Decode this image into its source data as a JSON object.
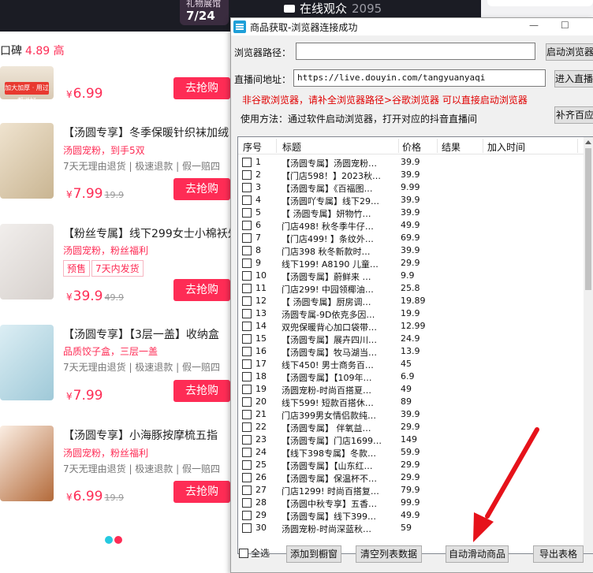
{
  "shop": {
    "gift_label": "礼物展馆",
    "gift_date": "7/24",
    "online_label": "在线观众",
    "online_count": "2095",
    "rating_label": "口碑",
    "rating_value": "4.89 高",
    "buy_label": "去抢购",
    "currency": "¥",
    "products": [
      {
        "title": "",
        "sub": "",
        "service": "",
        "price": "6.99",
        "orig": "",
        "badge": "加大加厚 · 用过都说好"
      },
      {
        "title": "【汤圆专享】冬季保暖针织袜加绒",
        "sub": "汤圆宠粉，到手5双",
        "service": "7天无理由退货 | 极速退款 | 假一赔四",
        "price": "7.99",
        "orig": "19.9"
      },
      {
        "title": "【粉丝专属】线下299女士小棉袄外",
        "sub": "汤圆宠粉，粉丝福利",
        "tags": [
          "预售",
          "7天内发货"
        ],
        "price": "39.9",
        "orig": "49.9"
      },
      {
        "title": "【汤圆专享】【3层一盖】收纳盒",
        "sub": "品质饺子盒，三层一盖",
        "service": "7天无理由退货 | 极速退款 | 假一赔四",
        "price": "7.99",
        "orig": ""
      },
      {
        "title": "【汤圆专享】小海豚按摩梳五指",
        "sub": "汤圆宠粉，粉丝福利",
        "service": "7天无理由退货 | 极速退款 | 假一赔四",
        "price": "6.99",
        "orig": "19.9"
      }
    ]
  },
  "window": {
    "title": "商品获取-浏览器连接成功",
    "minimize": "—",
    "maximize": "☐",
    "browser_path_label": "浏览器路径：",
    "browser_path_value": "",
    "start_browser_btn": "启动浏览器",
    "live_url_label": "直播间地址：",
    "live_url_value": "https://live.douyin.com/tangyuanyaqi",
    "enter_live_btn": "进入直播间",
    "red_tip": "非谷歌浏览器，请补全浏览器路径>谷歌浏览器 可以直接启动浏览器",
    "usage_text": "使用方法：通过软件启动浏览器，打开对应的抖音直播间",
    "fill_btn": "补齐百应",
    "columns": {
      "no": "序号",
      "title": "标题",
      "price": "价格",
      "result": "结果",
      "time": "加入时间"
    },
    "rows": [
      {
        "no": "1",
        "title": "【汤圆专属】汤圆宠粉…",
        "price": "39.9"
      },
      {
        "no": "2",
        "title": "【门店598！】2023秋…",
        "price": "39.9"
      },
      {
        "no": "3",
        "title": "【汤圆专属】《百福图…",
        "price": "9.99"
      },
      {
        "no": "4",
        "title": "【汤圆吖专属】线下29…",
        "price": "39.9"
      },
      {
        "no": "5",
        "title": "【  汤圆专属】妍物竹…",
        "price": "39.9"
      },
      {
        "no": "6",
        "title": "门店498! 秋冬季牛仔…",
        "price": "49.9"
      },
      {
        "no": "7",
        "title": "【门店499! 】条纹外…",
        "price": "69.9"
      },
      {
        "no": "8",
        "title": "门店398  秋冬新款时…",
        "price": "39.9"
      },
      {
        "no": "9",
        "title": "线下199! A8190 儿童…",
        "price": "29.9"
      },
      {
        "no": "10",
        "title": "【汤圆专属】蔚鲜来 …",
        "price": "9.9"
      },
      {
        "no": "11",
        "title": "门店299! 中园领椰油…",
        "price": "25.8"
      },
      {
        "no": "12",
        "title": "【 汤圆专属】厨房调…",
        "price": "19.89"
      },
      {
        "no": "13",
        "title": "汤圆专属-9D依克多因…",
        "price": "19.9"
      },
      {
        "no": "14",
        "title": "双兜保暖背心加口袋带…",
        "price": "12.99"
      },
      {
        "no": "15",
        "title": "【汤圆专属】展卉四川…",
        "price": "24.9"
      },
      {
        "no": "16",
        "title": "【汤圆专属】牧马湖当…",
        "price": "13.9"
      },
      {
        "no": "17",
        "title": "线下450! 男士商务百…",
        "price": "45"
      },
      {
        "no": "18",
        "title": "【汤圆专属】【109年…",
        "price": "6.9"
      },
      {
        "no": "19",
        "title": "汤圆宠粉-时尚百搭夏…",
        "price": "49"
      },
      {
        "no": "20",
        "title": "线下599! 短款百搭休…",
        "price": "89"
      },
      {
        "no": "21",
        "title": "门店399男女情侣款纯…",
        "price": "39.9"
      },
      {
        "no": "22",
        "title": "【汤圆专属】 伴氧益…",
        "price": "29.9"
      },
      {
        "no": "23",
        "title": "【汤圆专属】门店1699…",
        "price": "149"
      },
      {
        "no": "24",
        "title": "【线下398专属】冬款…",
        "price": "59.9"
      },
      {
        "no": "25",
        "title": "【汤圆专属】【山东红…",
        "price": "29.9"
      },
      {
        "no": "26",
        "title": "【汤圆专属】保温杯不…",
        "price": "29.9"
      },
      {
        "no": "27",
        "title": "门店1299! 时尚百搭复…",
        "price": "79.9"
      },
      {
        "no": "28",
        "title": "【汤圆中秋专享】五香…",
        "price": "99.9"
      },
      {
        "no": "29",
        "title": "【汤圆专属】线下399…",
        "price": "49.9"
      },
      {
        "no": "30",
        "title": "汤圆宠粉-时尚深蓝秋…",
        "price": "59"
      }
    ],
    "select_all": "全选",
    "add_window_btn": "添加到橱窗",
    "clear_btn": "清空列表数据",
    "auto_scroll_btn": "自动滑动商品",
    "export_btn": "导出表格"
  },
  "colors": {
    "accent": "#fe2c55",
    "arrow": "#e6121a",
    "tip": "#e00000"
  }
}
